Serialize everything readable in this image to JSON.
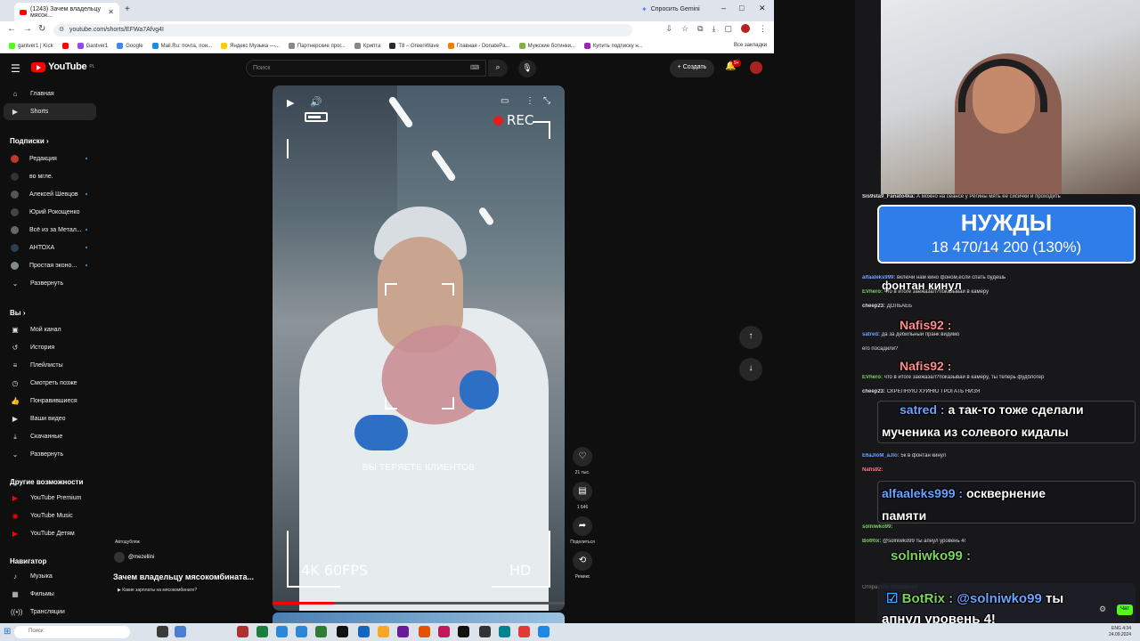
{
  "browser": {
    "tab_title": "(1243) Зачем владельцу мясок...",
    "url": "youtube.com/shorts/EFWa7Afvg4I",
    "gemini": "Спросить Gemini",
    "bookmarks": [
      "gantver1 | Kick",
      "",
      "Gantver1",
      "Google",
      "Mail.Ru: почта, пои...",
      "Яндекс Музыка —...",
      "Партнерские прог...",
      "Крипта",
      "T8 – GreenWave",
      "Главная - DonatePa...",
      "Мужские ботинки...",
      "Купить подписку н..."
    ],
    "all_bookmarks": "Все закладки"
  },
  "header": {
    "logo": "YouTube",
    "region": "PL",
    "search_placeholder": "Поиск",
    "create": "Создать",
    "notifications": "9+"
  },
  "sidebar": {
    "main": [
      {
        "label": "Главная",
        "icon": "home-icon"
      },
      {
        "label": "Shorts",
        "icon": "shorts-icon"
      }
    ],
    "subs_title": "Подписки",
    "subs": [
      {
        "label": "Редакция",
        "color": "#c0392b"
      },
      {
        "label": "во мгле.",
        "color": "#333333"
      },
      {
        "label": "Алексей Шевцов",
        "color": "#555555"
      },
      {
        "label": "Юрий Рокощенко",
        "color": "#444444"
      },
      {
        "label": "Всё из за Метал...",
        "color": "#666666"
      },
      {
        "label": "АНТОХА",
        "color": "#2c3e50"
      },
      {
        "label": "Простая эконо...",
        "color": "#7f8c8d"
      }
    ],
    "subs_more": "Развернуть",
    "you_title": "Вы",
    "you": [
      {
        "label": "Мой канал",
        "icon": "channel-icon"
      },
      {
        "label": "История",
        "icon": "history-icon"
      },
      {
        "label": "Плейлисты",
        "icon": "playlist-icon"
      },
      {
        "label": "Смотреть позже",
        "icon": "clock-icon"
      },
      {
        "label": "Понравившиеся",
        "icon": "like-icon"
      },
      {
        "label": "Ваши видео",
        "icon": "video-icon"
      },
      {
        "label": "Скачанные",
        "icon": "download-icon"
      },
      {
        "label": "Развернуть",
        "icon": "chevron-down-icon"
      }
    ],
    "other_title": "Другие возможности",
    "other": [
      {
        "label": "YouTube Premium"
      },
      {
        "label": "YouTube Music"
      },
      {
        "label": "YouTube Детям"
      }
    ],
    "nav_title": "Навигатор",
    "nav": [
      {
        "label": "Музыка",
        "icon": "music-icon"
      },
      {
        "label": "Фильмы",
        "icon": "film-icon"
      },
      {
        "label": "Трансляции",
        "icon": "live-icon"
      }
    ]
  },
  "video": {
    "rec": "REC",
    "caption": "ВЫ ТЕРЯЕТЕ КЛИЕНТОВ",
    "fps": "4K 60FPS",
    "hd": "HD",
    "progress": 0.21,
    "autopark": "Автодубляж",
    "channel": "@mezellini",
    "title": "Зачем владельцу мясокомбината...",
    "link": "Какие зарплаты на мясокомбинате?"
  },
  "actions": {
    "likes": "21 тыс.",
    "comments": "1 646",
    "share": "Поделиться",
    "remix": "Ремикс"
  },
  "stream": {
    "needs_title": "НУЖДЫ",
    "needs_value": "18 470/14 200 (130%)",
    "alert_fountain": "фонтан кинул",
    "alert_nafis1": "Nafis92 :",
    "alert_nafis2": "Nafis92 :",
    "alert_satred_name": "satred :",
    "alert_satred_text1": "а так-то тоже сделали",
    "alert_satred_text2": "мученика из солевого кидалы",
    "alert_alfa_name": "alfaaleks999 :",
    "alert_alfa_text1": "осквернение",
    "alert_alfa_text2": "памяти",
    "alert_soln": "solniwko99 :",
    "botrix_name": "BotRix :",
    "botrix_mention": "@solniwko99",
    "botrix_text1": "ты",
    "botrix_text2": "апнул уровень 4!",
    "chat": [
      {
        "name": "Sis9sta9_Fanato4ka:",
        "text": "А можно на сеансе у Регины мять ее сисички и проходить",
        "color": "#ffffff"
      },
      {
        "name": "alfaaleks999:",
        "text": "включи нам кино фоном,если спать будешь",
        "color": "#6aa3ff"
      },
      {
        "name": "EVhero:",
        "text": "что в итоге заежазал?показывай в камеру",
        "color": "#7ad35c"
      },
      {
        "name": "cheep23:",
        "text": "ДОЛБАЕБ",
        "color": "#bbbbbb"
      },
      {
        "name": "satred:",
        "text": "да за дебильный пранк видимо",
        "color": "#6aa3ff"
      },
      {
        "name": "",
        "text": "его посадили?",
        "color": "#bbbbbb"
      },
      {
        "name": "EVhero:",
        "text": "что в итоге заежазал?показывай в камеру, ты теперь фудблогер",
        "color": "#7ad35c"
      },
      {
        "name": "cheep23:",
        "text": "СКРЕПНУЮ ХУЙНЮ ТРОГАТЬ НИЗЯ",
        "color": "#bbbbbb"
      },
      {
        "name": "EVhero:",
        "text": "что в итоге заежазал?показывай в камеру, ты теперь фудблогер",
        "color": "#7ad35c"
      },
      {
        "name": "E6aJIoM_aJlo:",
        "text": "5к в фонтан кинул",
        "color": "#6aa3ff"
      },
      {
        "name": "Nafis92:",
        "text": "",
        "color": "#ff7a7a"
      },
      {
        "name": "alfaaleks999:",
        "text": "осквернение памяти",
        "color": "#6aa3ff"
      },
      {
        "name": "solniwko99:",
        "text": "",
        "color": "#7ad35c"
      },
      {
        "name": "BotRix:",
        "text": "@solniwko99 ты апнул уровень 4!",
        "color": "#7ad35c"
      }
    ],
    "send_placeholder": "Отправить сообщение",
    "chat_button": "Чат"
  },
  "taskbar": {
    "search": "Поиск",
    "time": "4:34",
    "date": "24.09.2024",
    "lang": "ENG"
  }
}
